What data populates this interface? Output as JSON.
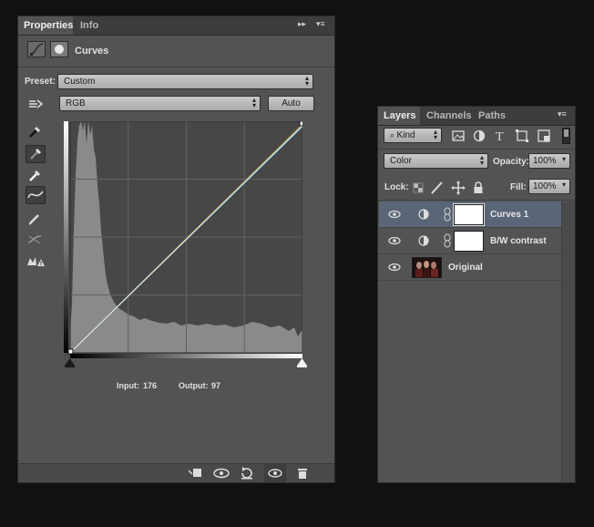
{
  "properties": {
    "tabs": [
      {
        "label": "Properties",
        "active": true
      },
      {
        "label": "Info",
        "active": false
      }
    ],
    "collapse_glyph": "▸▸",
    "menu_glyph": "▾≡",
    "adjustment_title": "Curves",
    "preset_label": "Preset:",
    "preset_value": "Custom",
    "channel_value": "RGB",
    "auto_button": "Auto",
    "input_label": "Input:",
    "input_value": "176",
    "output_label": "Output:",
    "output_value": "97",
    "tools": [
      "targeted-adjustment-hand-icon",
      "black-point-eyedropper-icon",
      "gray-point-eyedropper-icon",
      "white-point-eyedropper-icon",
      "curve-points-icon",
      "pencil-draw-icon",
      "smooth-curve-icon",
      "clipping-warning-icon"
    ],
    "bottom_icons": [
      "clip-to-layer-icon",
      "view-previous-state-icon",
      "reset-icon",
      "visibility-eye-icon",
      "trash-icon"
    ],
    "curve_colors": {
      "red": "#d94a3a",
      "green": "#4cc94c",
      "blue": "#5a8ee0",
      "composite": "#ffffff"
    }
  },
  "layers": {
    "tabs": [
      {
        "label": "Layers",
        "active": true
      },
      {
        "label": "Channels",
        "active": false
      },
      {
        "label": "Paths",
        "active": false
      }
    ],
    "menu_glyph": "▾≡",
    "filter_kind": "Kind",
    "blend_mode": "Color",
    "opacity_label": "Opacity:",
    "opacity_value": "100%",
    "lock_label": "Lock:",
    "fill_label": "Fill:",
    "fill_value": "100%",
    "items": [
      {
        "name": "Curves 1",
        "selected": true,
        "type": "adjustment"
      },
      {
        "name": "B/W contrast",
        "selected": false,
        "type": "adjustment"
      },
      {
        "name": "Original",
        "selected": false,
        "type": "image"
      }
    ]
  }
}
